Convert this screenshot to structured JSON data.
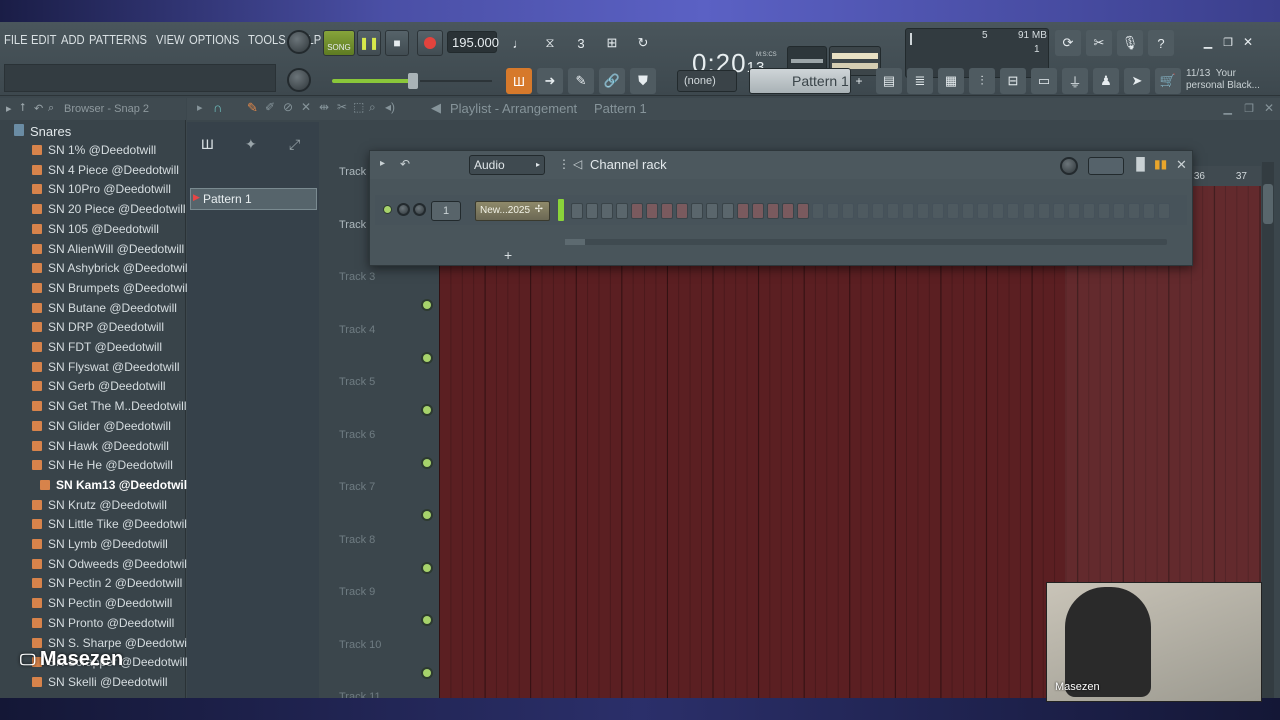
{
  "menu": [
    "FILE",
    "EDIT",
    "ADD",
    "PATTERNS",
    "VIEW",
    "OPTIONS",
    "TOOLS",
    "HELP"
  ],
  "transport": {
    "mode": "SONG",
    "tempo": "195.000",
    "time_main": "0:20",
    "time_small": "13",
    "time_format": "M:S:CS"
  },
  "meters": {
    "cpu": "5",
    "memory": "91 MB",
    "polyphony": "1"
  },
  "pattern_select": {
    "none_label": "(none)",
    "pattern": "Pattern 1",
    "plus": "+"
  },
  "news": {
    "count": "11/13",
    "text": "Your personal Black..."
  },
  "browser": {
    "title": "Browser - Snap 2",
    "folder": "Snares",
    "items": [
      "SN 1% @Deedotwill",
      "SN 4 Piece @Deedotwill",
      "SN 10Pro @Deedotwill",
      "SN 20 Piece @Deedotwill",
      "SN 105 @Deedotwill",
      "SN AlienWill @Deedotwill",
      "SN Ashybrick @Deedotwill",
      "SN Brumpets @Deedotwill",
      "SN Butane @Deedotwill",
      "SN DRP @Deedotwill",
      "SN FDT @Deedotwill",
      "SN Flyswat @Deedotwill",
      "SN Gerb @Deedotwill",
      "SN Get The M..Deedotwill",
      "SN Glider @Deedotwill",
      "SN Hawk @Deedotwill",
      "SN He He @Deedotwill",
      "SN Kam13 @Deedotwill",
      "SN Krutz @Deedotwill",
      "SN Little Tike @Deedotwill",
      "SN Lymb @Deedotwill",
      "SN Odweeds @Deedotwill",
      "SN Pectin 2 @Deedotwill",
      "SN Pectin @Deedotwill",
      "SN Pronto @Deedotwill",
      "SN S. Sharpe @Deedotwill",
      "SN Scrapper @Deedotwill",
      "SN Skelli @Deedotwill"
    ],
    "selected_index": 17
  },
  "playlist": {
    "title": "Playlist - Arrangement",
    "pattern_crumb": "Pattern 1",
    "pattern_item": "Pattern 1",
    "ruler_end": [
      "36",
      "37"
    ],
    "tracks": [
      "Track",
      "Track",
      "Track 3",
      "Track 4",
      "Track 5",
      "Track 6",
      "Track 7",
      "Track 8",
      "Track 9",
      "Track 10",
      "Track 11"
    ]
  },
  "channel_rack": {
    "title": "Channel rack",
    "filter": "Audio",
    "channel_number": "1",
    "channel_name": "New...2025",
    "add": "+",
    "steps_red": [
      4,
      5,
      6,
      7,
      11,
      12,
      13,
      14,
      15
    ],
    "steps_bright_count": 16,
    "steps_total": 40
  },
  "overlay": {
    "watermark": "Masezen",
    "cam_name": "Masezen"
  }
}
